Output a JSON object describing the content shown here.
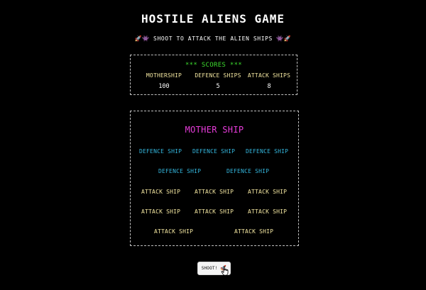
{
  "title": "Hostile Aliens Game",
  "subtitle": {
    "left_emoji": "🚀👾",
    "text": "Shoot to attack the alien ships",
    "right_emoji": "👾🚀"
  },
  "scores": {
    "heading": "*** SCORES ***",
    "columns": [
      {
        "label": "MOTHERSHIP",
        "value": "100"
      },
      {
        "label": "DEFENCE SHIPS",
        "value": "5"
      },
      {
        "label": "ATTACK SHIPS",
        "value": "8"
      }
    ]
  },
  "fleet": {
    "mothership": "MOTHER SHIP",
    "defence_label": "DEFENCE SHIP",
    "attack_label": "ATTACK SHIP",
    "defence_ships": [
      "DEFENCE SHIP",
      "DEFENCE SHIP",
      "DEFENCE SHIP",
      "DEFENCE SHIP",
      "DEFENCE SHIP"
    ],
    "attack_ships": [
      "ATTACK SHIP",
      "ATTACK SHIP",
      "ATTACK SHIP",
      "ATTACK SHIP",
      "ATTACK SHIP",
      "ATTACK SHIP",
      "ATTACK SHIP",
      "ATTACK SHIP"
    ]
  },
  "shoot_button": {
    "label": "SHOOT!",
    "icon": "rocket-icon",
    "emoji": "🚀"
  },
  "colors": {
    "background": "#000000",
    "scores_heading": "#3ddc2f",
    "mothership": "#e83cdb",
    "defence": "#34b6dd",
    "attack": "#f3e6a0"
  }
}
